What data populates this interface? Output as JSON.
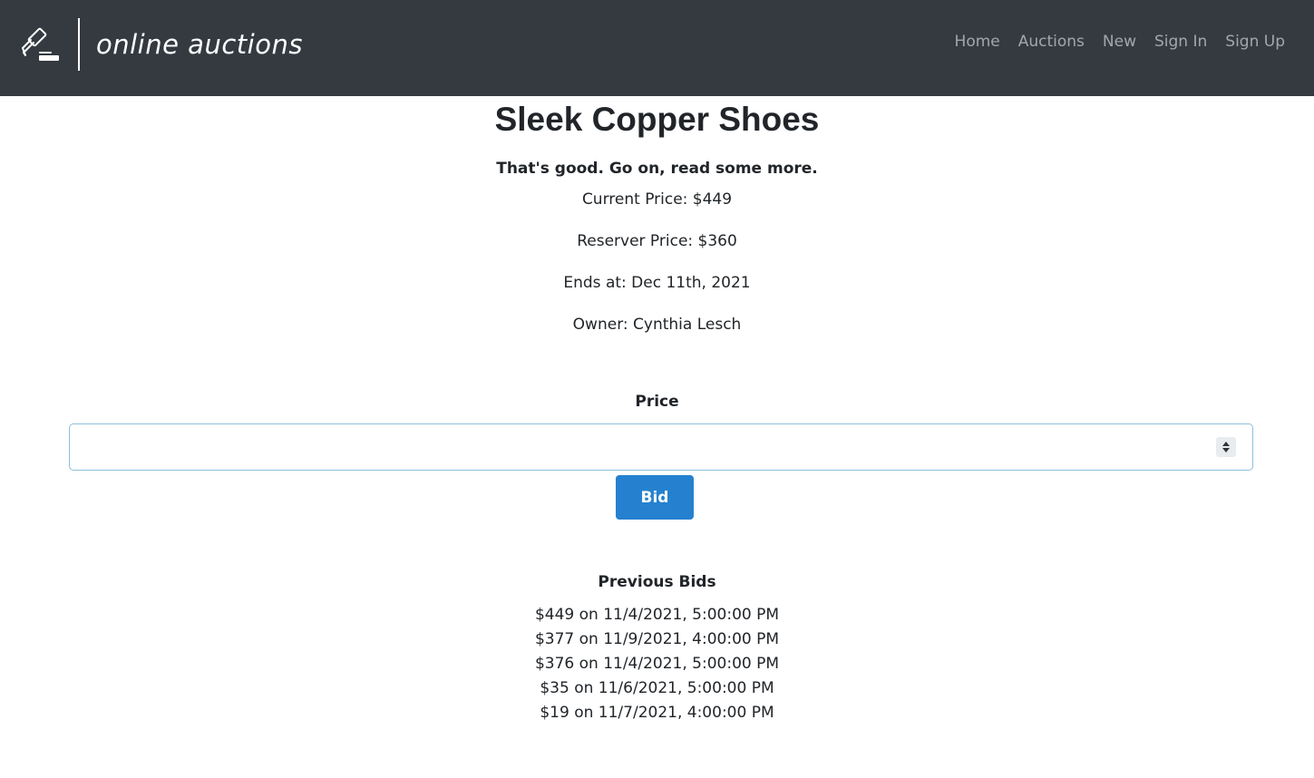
{
  "brand": {
    "name": "online auctions",
    "icon": "gavel-icon"
  },
  "nav": {
    "items": [
      {
        "label": "Home"
      },
      {
        "label": "Auctions"
      },
      {
        "label": "New"
      },
      {
        "label": "Sign In"
      },
      {
        "label": "Sign Up"
      }
    ]
  },
  "auction": {
    "title": "Sleek Copper Shoes",
    "description": "That's good. Go on, read some more.",
    "current_price": "Current Price: $449",
    "reserve_price": "Reserver Price: $360",
    "ends_at": "Ends at: Dec 11th, 2021",
    "owner": "Owner: Cynthia Lesch"
  },
  "bid_form": {
    "price_label": "Price",
    "price_value": "",
    "bid_button_label": "Bid"
  },
  "previous_bids": {
    "heading": "Previous Bids",
    "items": [
      "$449 on 11/4/2021, 5:00:00 PM",
      "$377 on 11/9/2021, 4:00:00 PM",
      "$376 on 11/4/2021, 5:00:00 PM",
      "$35 on 11/6/2021, 5:00:00 PM",
      "$19 on 11/7/2021, 4:00:00 PM"
    ]
  },
  "colors": {
    "navbar": "#343a40",
    "primary_button": "#2581cf",
    "input_border": "#8cc0d9"
  }
}
